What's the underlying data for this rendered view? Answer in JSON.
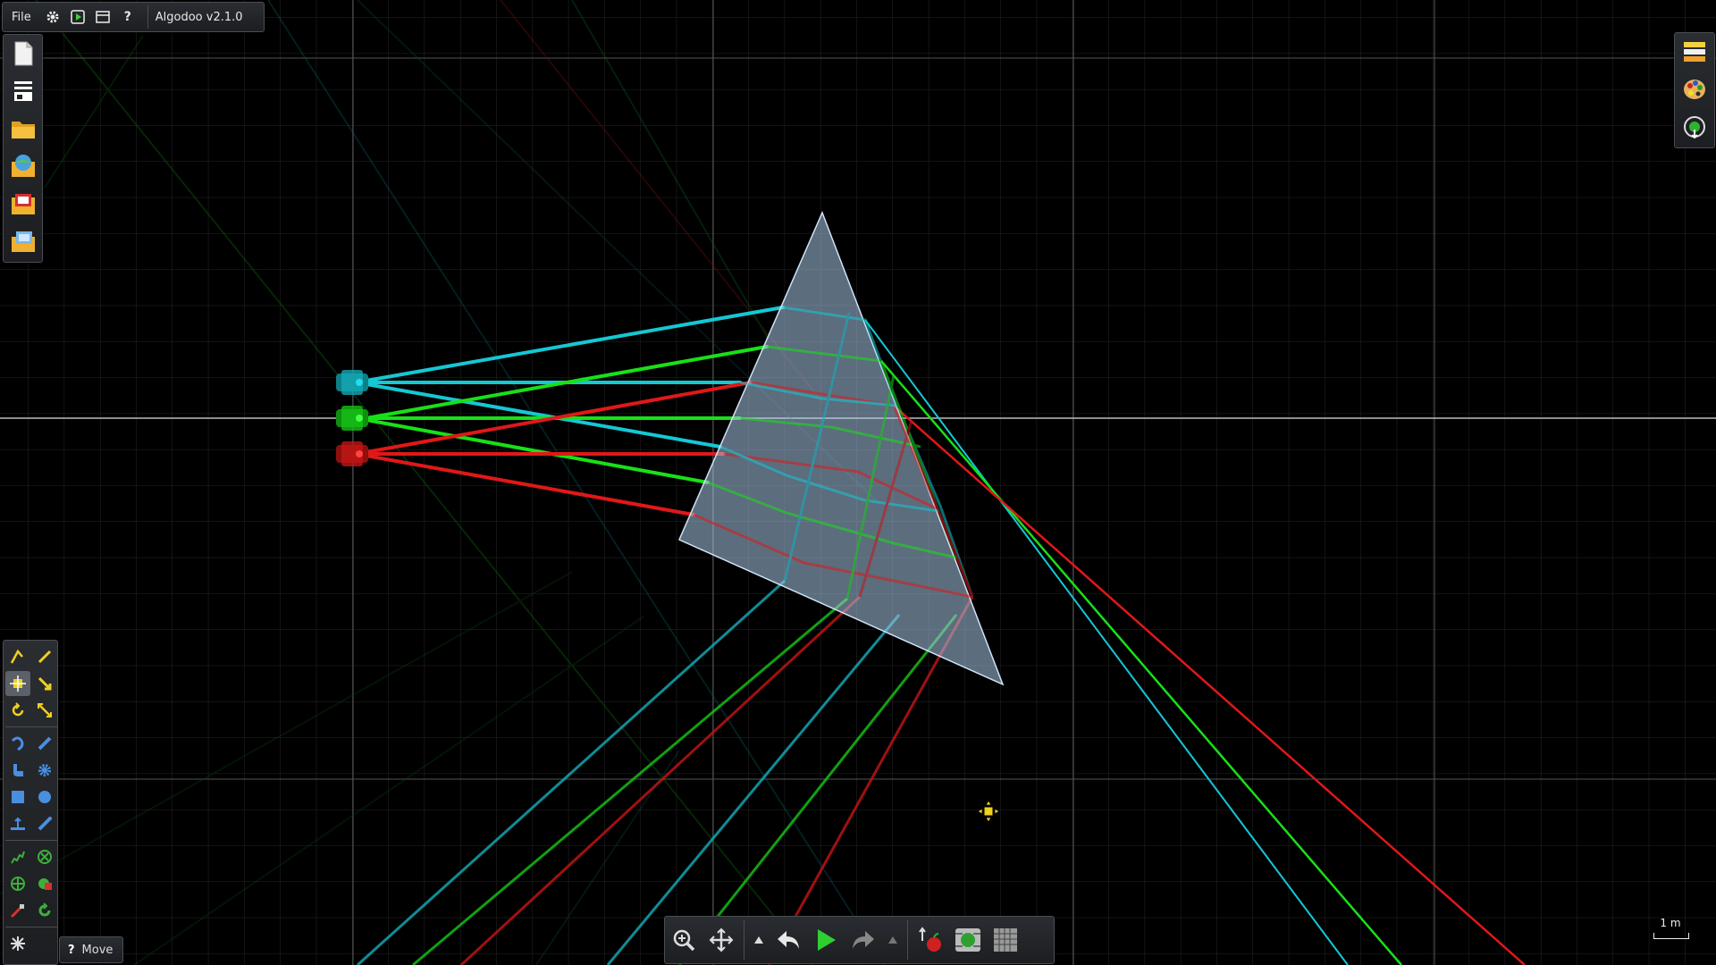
{
  "app": {
    "title": "Algodoo v2.1.0"
  },
  "menu": {
    "file_label": "File"
  },
  "top_icons": [
    "gear-icon",
    "play-scene-icon",
    "window-icon",
    "help-icon"
  ],
  "left_toolbar": [
    "new-scene-icon",
    "scene-list-icon",
    "open-folder-icon",
    "algobox-icon",
    "scene-gallery-icon",
    "save-folder-icon"
  ],
  "right_toolbar": [
    "layers-icon",
    "palette-icon",
    "add-object-icon"
  ],
  "tools": [
    "sketch-tool",
    "pen-tool",
    "move-tool",
    "drag-tool",
    "rotate-tool",
    "scale-tool",
    "rope-tool",
    "knife-tool",
    "brush-tool",
    "gear-tool",
    "box-tool",
    "circle-tool",
    "plane-tool",
    "cut-tool",
    "spring-tool",
    "hinge-tool",
    "tracer-tool",
    "fixate-tool",
    "laser-tool",
    "thruster-tool",
    "chain-tool"
  ],
  "hint": {
    "q": "?",
    "label": "Move"
  },
  "bottom_toolbar": [
    "zoom-icon",
    "pan-icon",
    "undo-menu-arrow",
    "undo-icon",
    "play-icon",
    "redo-icon",
    "redo-menu-arrow",
    "gravity-icon",
    "air-friction-icon",
    "grid-icon"
  ],
  "scale": {
    "label": "1 m"
  },
  "colors": {
    "cyan": "#14c8d4",
    "green": "#18e018",
    "red": "#e01818",
    "prism": "#a8c6e6",
    "grid": "#3a3a3a",
    "axis": "#bdbdbd"
  }
}
